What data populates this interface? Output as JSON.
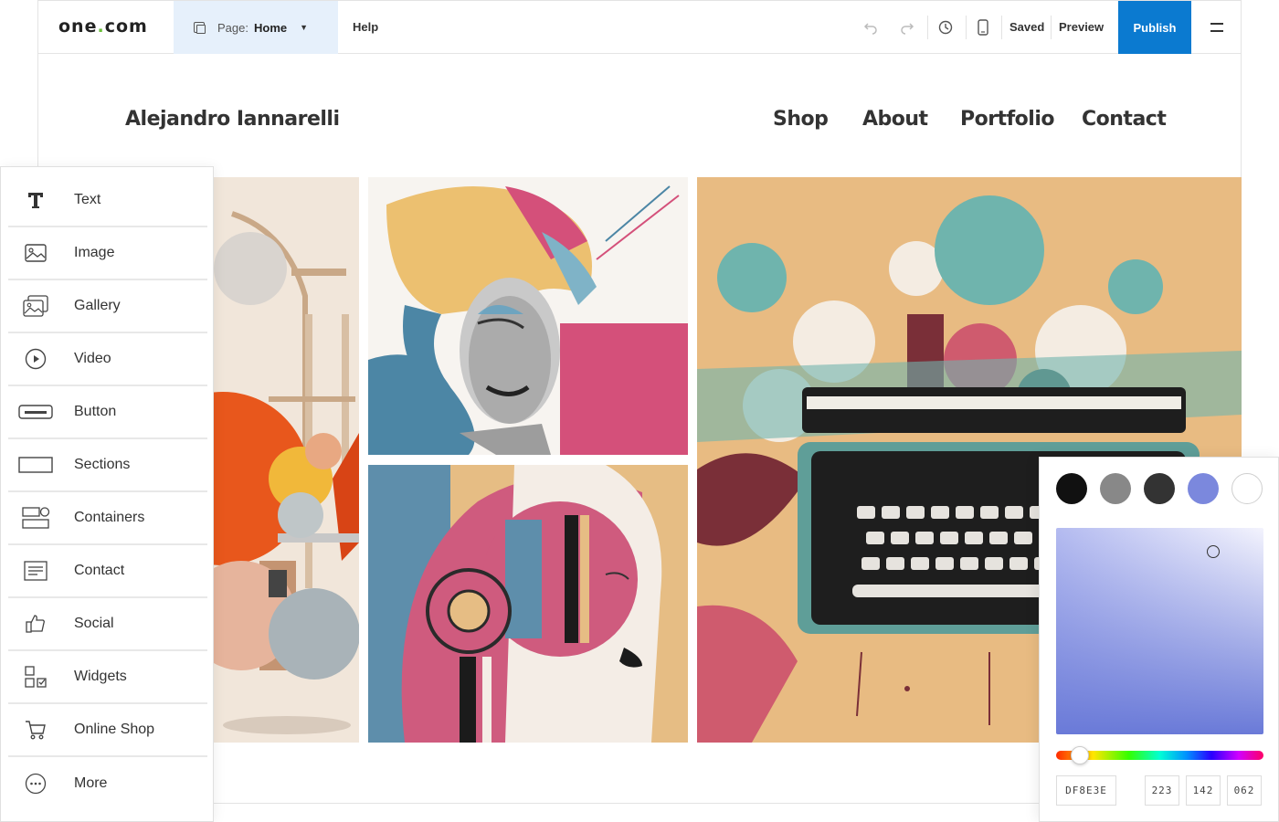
{
  "toolbar": {
    "logo_main": "one",
    "logo_dot": ".",
    "logo_tail": "com",
    "page_label": "Page:",
    "page_value": "Home",
    "help": "Help",
    "saved": "Saved",
    "preview": "Preview",
    "publish": "Publish"
  },
  "site": {
    "name": "Alejandro Iannarelli",
    "nav": [
      "Shop",
      "About",
      "Portfolio",
      "Contact"
    ]
  },
  "panel": {
    "items": [
      {
        "label": "Text",
        "icon": "text-icon"
      },
      {
        "label": "Image",
        "icon": "image-icon"
      },
      {
        "label": "Gallery",
        "icon": "gallery-icon"
      },
      {
        "label": "Video",
        "icon": "video-icon"
      },
      {
        "label": "Button",
        "icon": "button-icon"
      },
      {
        "label": "Sections",
        "icon": "sections-icon"
      },
      {
        "label": "Containers",
        "icon": "containers-icon"
      },
      {
        "label": "Contact",
        "icon": "contact-icon"
      },
      {
        "label": "Social",
        "icon": "social-icon"
      },
      {
        "label": "Widgets",
        "icon": "widgets-icon"
      },
      {
        "label": "Online Shop",
        "icon": "cart-icon"
      },
      {
        "label": "More",
        "icon": "more-icon"
      }
    ]
  },
  "color_picker": {
    "swatches": [
      "#111111",
      "#888888",
      "#333333",
      "#7b88dd",
      "#ffffff"
    ],
    "hex": "DF8E3E",
    "r": "223",
    "g": "142",
    "b": "062"
  },
  "colors": {
    "accent": "#0b7ad0",
    "page_select_bg": "#e6f0fb",
    "logo_dot": "#6bbf3b"
  }
}
